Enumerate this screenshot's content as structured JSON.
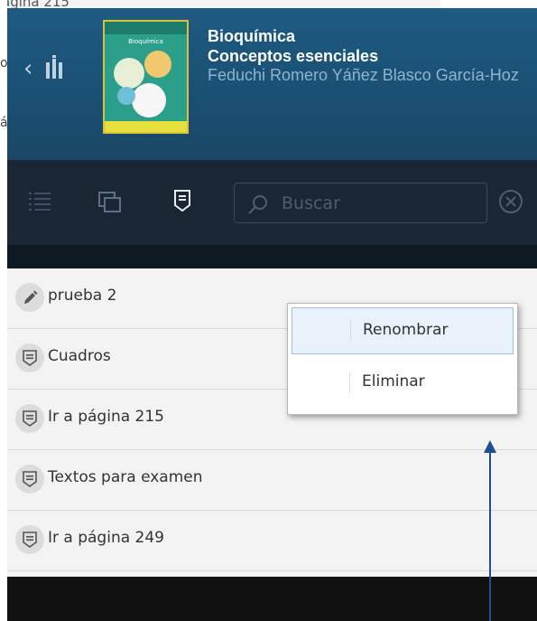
{
  "background": {
    "top_fragment": "ágina 215",
    "left_fragments": [
      "o",
      "á"
    ]
  },
  "book": {
    "title_line1": "Bioquímica",
    "title_line2": "Conceptos esenciales",
    "authors": "Feduchi Romero Yáñez Blasco García-Hoz",
    "cover_title": "Bioquímica"
  },
  "toolbar": {
    "search_placeholder": "Buscar"
  },
  "list": {
    "items": [
      {
        "label": "prueba 2",
        "icon": "pencil-icon"
      },
      {
        "label": "Cuadros",
        "icon": "note-icon"
      },
      {
        "label": "Ir a página 215",
        "icon": "note-icon"
      },
      {
        "label": "Textos para examen",
        "icon": "note-icon"
      },
      {
        "label": "Ir a página 249",
        "icon": "note-icon"
      }
    ]
  },
  "context_menu": {
    "items": [
      {
        "label": "Renombrar",
        "highlighted": true
      },
      {
        "label": "Eliminar",
        "highlighted": false
      }
    ]
  },
  "colors": {
    "header": "#1a4f72",
    "toolbar": "#1a2634",
    "list_bg": "#f3f3f3",
    "arrow": "#1f4f8f"
  }
}
